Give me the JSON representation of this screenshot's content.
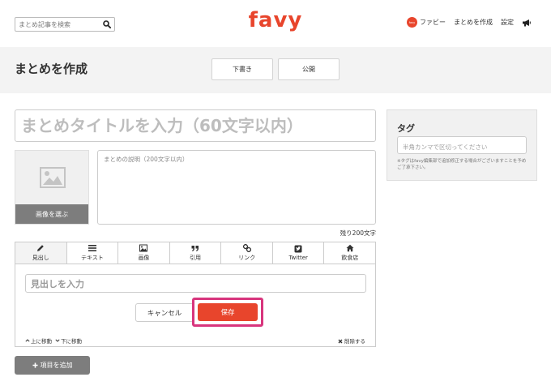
{
  "header": {
    "search_placeholder": "まとめ記事を検索",
    "logo": "favy",
    "avatar_text": "favy",
    "nav": [
      "ファビー",
      "まとめを作成",
      "設定"
    ]
  },
  "band": {
    "title": "まとめを作成",
    "draft_label": "下書き",
    "publish_label": "公開"
  },
  "editor": {
    "title_placeholder": "まとめタイトルを入力（60文字以内）",
    "choose_image_label": "画像を選ぶ",
    "desc_placeholder": "まとめの説明（200文字以内）",
    "remaining": "残り200文字",
    "tabs": [
      {
        "label": "見出し",
        "icon": "pencil-icon"
      },
      {
        "label": "テキスト",
        "icon": "list-icon"
      },
      {
        "label": "画像",
        "icon": "image-icon"
      },
      {
        "label": "引用",
        "icon": "quote-icon"
      },
      {
        "label": "リンク",
        "icon": "link-icon"
      },
      {
        "label": "Twitter",
        "icon": "twitter-icon"
      },
      {
        "label": "飲食店",
        "icon": "home-icon"
      }
    ],
    "heading_placeholder": "見出しを入力",
    "cancel_label": "キャンセル",
    "save_label": "保存",
    "move_up": "上に移動",
    "move_down": "下に移動",
    "delete": "削除する",
    "add_item": "項目を追加"
  },
  "tags": {
    "heading": "タグ",
    "placeholder": "半角カンマで区切ってください",
    "note": "※タグはfavy編集部で追加修正する場合がございますことを予めご了承下さい。"
  },
  "colors": {
    "brand": "#e8452c",
    "highlight": "#d8357d"
  }
}
